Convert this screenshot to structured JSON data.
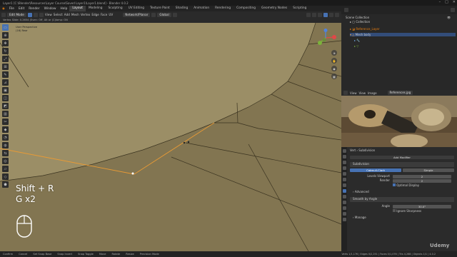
{
  "window": {
    "title": "Layer1 [C:\\Blender\\Resources\\Layer Course\\Saved Layer1\\Layer1.blend] - Blender 4.0.2"
  },
  "menubar": {
    "menus": [
      "File",
      "Edit",
      "Render",
      "Window",
      "Help"
    ],
    "workspaces": [
      "Layout",
      "Modeling",
      "Sculpting",
      "UV Editing",
      "Texture Paint",
      "Shading",
      "Animation",
      "Rendering",
      "Compositing",
      "Geometry Nodes",
      "Scripting"
    ],
    "active_workspace": "Layout",
    "scene_label": "Scene",
    "viewlayer_label": "ViewLayer"
  },
  "viewport_header": {
    "mode": "Edit Mode",
    "menus": [
      "View",
      "Select",
      "Add",
      "Mesh",
      "Vertex",
      "Edge",
      "Face",
      "UV"
    ],
    "snap_mode": "Network/Planar",
    "orientation": "Global",
    "status_line": "Vertex Slide: 0.2654 (Even: Off, Alt or (C)lamp: ON"
  },
  "viewport": {
    "info_line1": "User Perspective",
    "info_line2": "(16) Rear",
    "shortcut_line1": "Shift + R",
    "shortcut_line2": "G x2",
    "mesh_color": "#8c7f58",
    "wire_color": "#3a3320",
    "selected_color": "#e89a35"
  },
  "outliner": {
    "header": "Scene Collection",
    "rows": [
      {
        "label": "Scene Collection",
        "level": 0
      },
      {
        "label": "Collection",
        "level": 1
      },
      {
        "label": "Reference_Layer",
        "level": 1
      },
      {
        "label": "Mesh body",
        "level": 1
      },
      {
        "label": "",
        "level": 1
      },
      {
        "label": "",
        "level": 1
      }
    ]
  },
  "image_editor": {
    "menus": [
      "View",
      "View",
      "Image"
    ],
    "image_name": "References.jpg"
  },
  "properties": {
    "object_label": "Vert",
    "modifier_tab": "Subdivision",
    "add_modifier": "Add Modifier",
    "modifier1": {
      "name": "Subdivision",
      "btn_catmull": "Catmull-Clark",
      "btn_simple": "Simple",
      "levels_viewport_label": "Levels Viewport",
      "levels_viewport": "2",
      "render_label": "Render",
      "render": "2",
      "optimal_display": "Optimal Display",
      "advanced": "Advanced"
    },
    "modifier2": {
      "name": "Smooth by Angle",
      "angle_label": "Angle",
      "angle": "30.0°",
      "ignore_sharpness": "Ignore Sharpness",
      "manage": "Manage"
    }
  },
  "statusbar": {
    "items": [
      "Confirm",
      "Cancel",
      "Set Snap Base",
      "Snap Invert",
      "Snap Toggle",
      "Move",
      "Rotate",
      "Resize",
      "Precision Mode"
    ],
    "version": "Verts 1/1,176 | Edges 0/2,251 | Faces 0/1,076 | Tris 4,268 | Objects 1/1 | 4.0.2"
  },
  "watermark": "Udemy"
}
